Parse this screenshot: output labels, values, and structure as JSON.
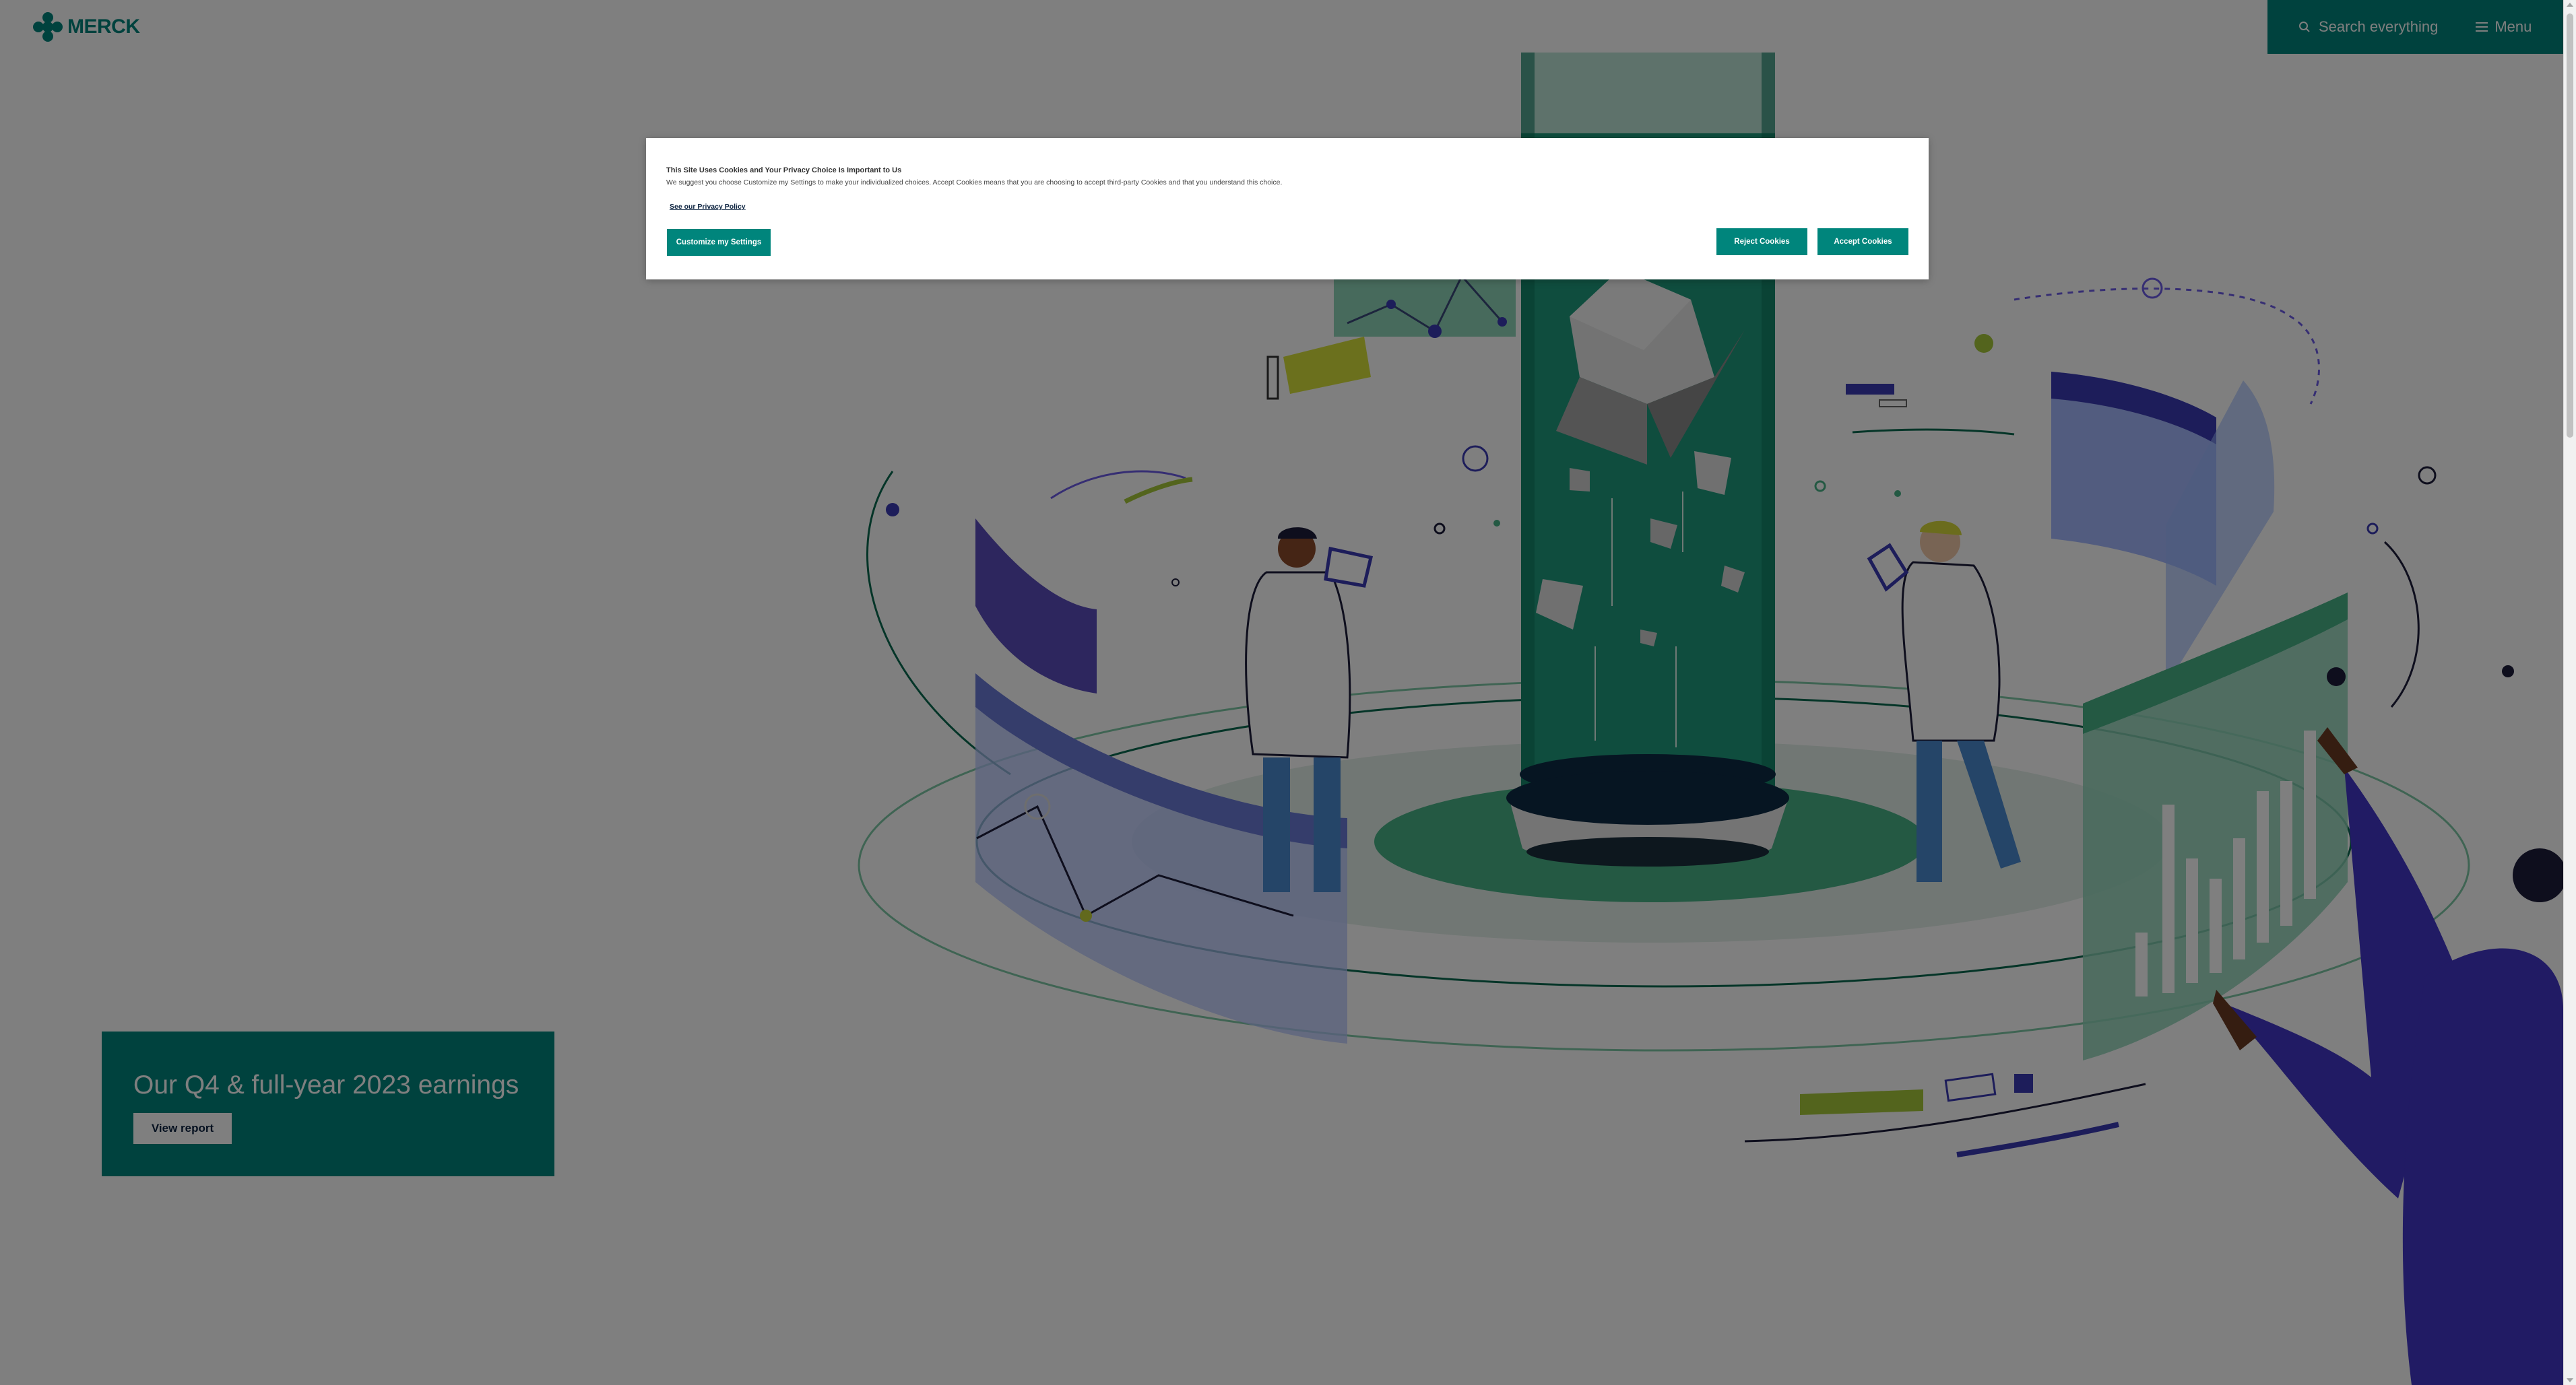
{
  "header": {
    "logo_text": "MERCK",
    "search_label": "Search everything",
    "menu_label": "Menu",
    "nav_color": "#00857c"
  },
  "hero": {
    "promo": {
      "title": "Our Q4 & full-year 2023 earnings",
      "button_label": "View report"
    },
    "illustration_icon": "laboratory-illustration"
  },
  "cookie_banner": {
    "title": "This Site Uses Cookies and Your Privacy Choice Is Important to Us",
    "text": "We suggest you choose Customize my Settings to make your individualized choices. Accept Cookies means that you are choosing to accept third-party Cookies and that you understand this choice.",
    "privacy_link": "See our Privacy Policy",
    "customize_label": "Customize my Settings",
    "reject_label": "Reject Cookies",
    "accept_label": "Accept Cookies",
    "button_color": "#00857c"
  }
}
